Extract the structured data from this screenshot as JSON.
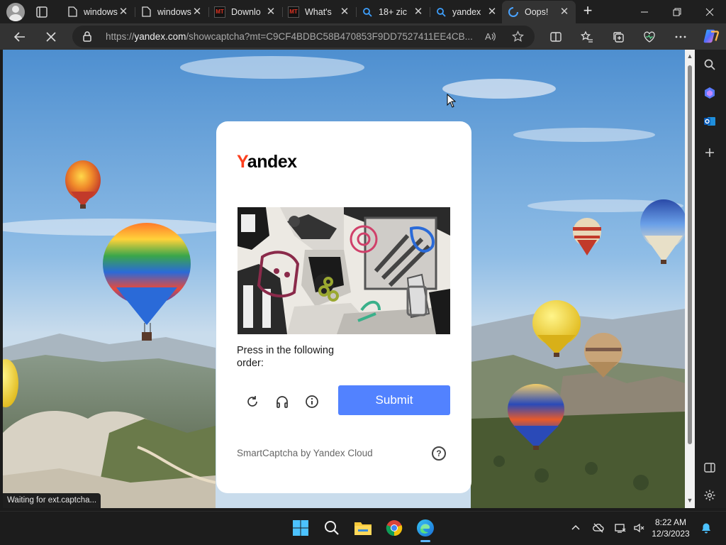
{
  "browser": {
    "tabs": [
      {
        "title": "windows",
        "favicon": "page-icon",
        "active": false
      },
      {
        "title": "windows",
        "favicon": "page-icon",
        "active": false
      },
      {
        "title": "Downlo",
        "favicon": "mt-icon",
        "favicon_text": "MT",
        "active": false
      },
      {
        "title": "What's",
        "favicon": "mt-icon",
        "favicon_text": "MT",
        "active": false
      },
      {
        "title": "18+ zic",
        "favicon": "search-icon",
        "active": false
      },
      {
        "title": "yandex",
        "favicon": "search-icon",
        "active": false
      },
      {
        "title": "Oops!",
        "favicon": "loading-icon",
        "active": true
      }
    ],
    "address": {
      "url_prefix": "https://",
      "url_host": "yandex.com",
      "url_path": "/showcaptcha?mt=C9CF4BDBC58B470853F9DD7527411EE4CB..."
    },
    "status_text": "Waiting for ext.captcha..."
  },
  "captcha": {
    "logo_y": "Y",
    "logo_rest": "andex",
    "instruction": "Press in the following order:",
    "submit_label": "Submit",
    "footer": "SmartCaptcha by Yandex Cloud",
    "help_glyph": "?"
  },
  "taskbar": {
    "time": "8:22 AM",
    "date": "12/3/2023"
  },
  "colors": {
    "yandex_red": "#fc3f1d",
    "submit_blue": "#5282ff",
    "sky": "#7fb2e0"
  }
}
